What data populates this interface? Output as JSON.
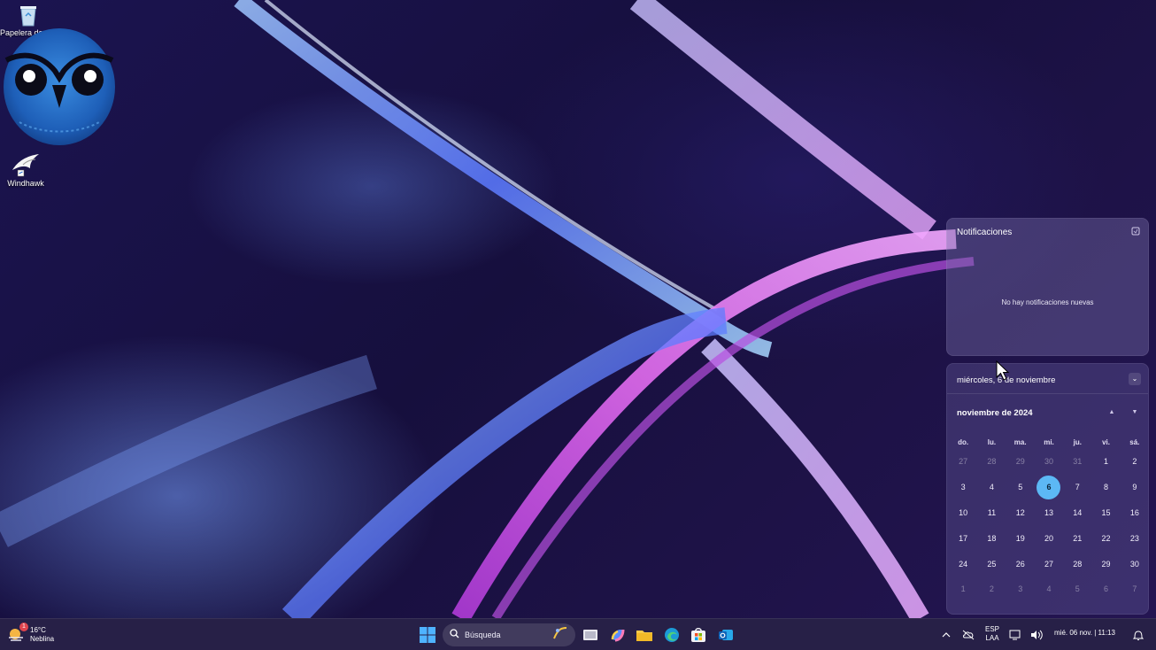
{
  "desktop": {
    "icons": [
      {
        "label": "Papelera de reciclaje",
        "icon": "recycle-bin-icon"
      },
      {
        "label": "Windhawk",
        "icon": "windhawk-icon"
      }
    ],
    "overlay_logo": "owl-logo"
  },
  "notifications": {
    "title": "Notificaciones",
    "empty_text": "No hay notificaciones nuevas",
    "settings_icon": "notification-settings-icon"
  },
  "calendar": {
    "header_date": "miércoles, 6 de noviembre",
    "month_label": "noviembre de 2024",
    "weekdays": [
      "do.",
      "lu.",
      "ma.",
      "mi.",
      "ju.",
      "vi.",
      "sá."
    ],
    "weeks": [
      [
        "27",
        "28",
        "29",
        "30",
        "31",
        "1",
        "2"
      ],
      [
        "3",
        "4",
        "5",
        "6",
        "7",
        "8",
        "9"
      ],
      [
        "10",
        "11",
        "12",
        "13",
        "14",
        "15",
        "16"
      ],
      [
        "17",
        "18",
        "19",
        "20",
        "21",
        "22",
        "23"
      ],
      [
        "24",
        "25",
        "26",
        "27",
        "28",
        "29",
        "30"
      ],
      [
        "1",
        "2",
        "3",
        "4",
        "5",
        "6",
        "7"
      ]
    ],
    "today": "6",
    "today_color": "#5cb8f5"
  },
  "taskbar": {
    "weather": {
      "temp": "16°C",
      "condition": "Neblina",
      "badge": "1"
    },
    "search_placeholder": "Búsqueda",
    "apps": [
      "start-icon",
      "task-view-icon",
      "copilot-icon",
      "file-explorer-icon",
      "edge-icon",
      "store-icon",
      "outlook-icon"
    ],
    "tray": {
      "lang_line1": "ESP",
      "lang_line2": "LAA",
      "datetime": "mié. 06 nov. | 11:13"
    }
  }
}
